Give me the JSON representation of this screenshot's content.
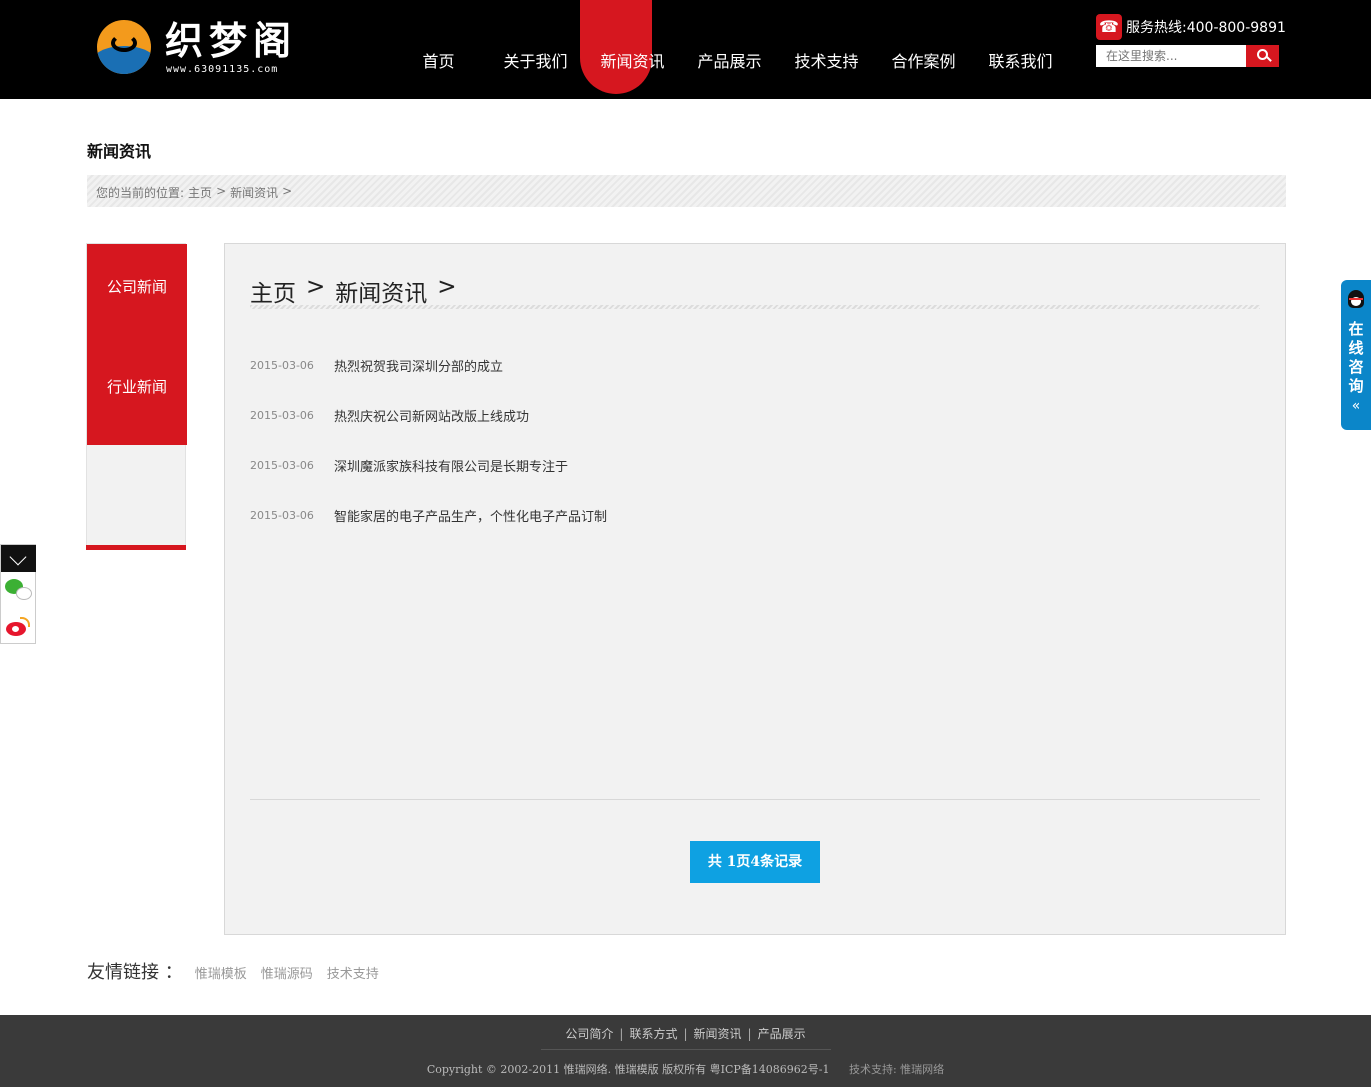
{
  "header": {
    "logo_text": "织梦阁",
    "logo_url": "www.63091135.com",
    "hotline": "服务热线:400-800-9891",
    "search_placeholder": "在这里搜索...",
    "nav": [
      "首页",
      "关于我们",
      "新闻资讯",
      "产品展示",
      "技术支持",
      "合作案例",
      "联系我们"
    ],
    "active_nav_index": 2,
    "accent_color": "#d6171f"
  },
  "page": {
    "title": "新闻资讯",
    "breadcrumb": [
      "您的当前的位置:",
      "主页",
      ">",
      "新闻资讯",
      ">"
    ]
  },
  "sidebar": {
    "items": [
      "公司新闻",
      "行业新闻"
    ]
  },
  "content": {
    "heading": [
      "主页",
      ">",
      "新闻资讯",
      ">"
    ],
    "news": [
      {
        "date": "2015-03-06",
        "title": "热烈祝贺我司深圳分部的成立"
      },
      {
        "date": "2015-03-06",
        "title": "热烈庆祝公司新网站改版上线成功"
      },
      {
        "date": "2015-03-06",
        "title": "深圳魔派家族科技有限公司是长期专注于"
      },
      {
        "date": "2015-03-06",
        "title": "智能家居的电子产品生产，个性化电子产品订制"
      }
    ],
    "pager": "共 1页4条记录"
  },
  "links": {
    "label": "友情链接 ：",
    "items": [
      "惟瑞模板",
      "惟瑞源码",
      "技术支持"
    ]
  },
  "footer": {
    "nav": [
      "公司简介",
      "联系方式",
      "新闻资讯",
      "产品展示"
    ],
    "copyright": "Copyright © 2002-2011 惟瑞网络. 惟瑞模版 版权所有 粤ICP备14086962号-1",
    "support": "技术支持: 惟瑞网络"
  },
  "float": {
    "qq_text": "在线咨询",
    "qq_arrow": "«"
  }
}
